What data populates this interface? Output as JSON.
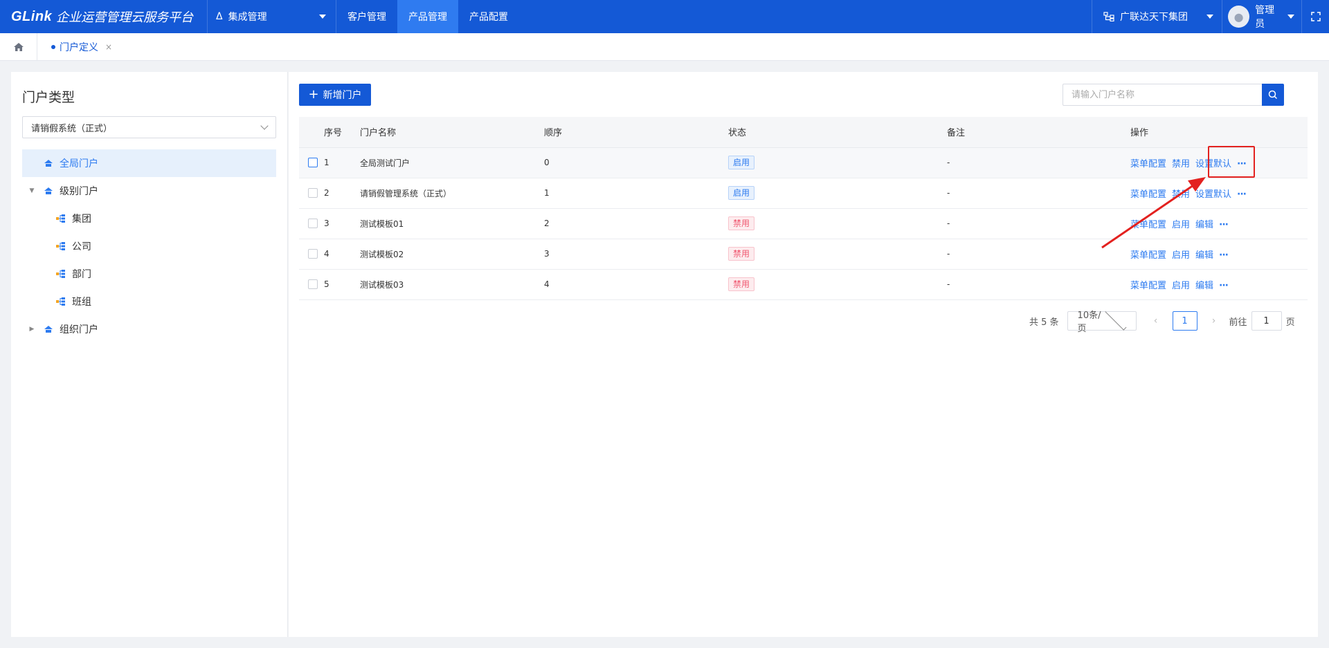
{
  "topbar": {
    "brand": "GLink",
    "title": "企业运营管理云服务平台",
    "module": "集成管理",
    "nav": [
      "客户管理",
      "产品管理",
      "产品配置"
    ],
    "active_nav": "产品管理",
    "org": "广联达天下集团",
    "user": "管理员"
  },
  "tabs": {
    "current": "门户定义",
    "close": "×"
  },
  "left": {
    "title": "门户类型",
    "select_value": "请销假系统（正式）",
    "tree": [
      {
        "label": "全局门户",
        "level": 0,
        "selected": true
      },
      {
        "label": "级别门户",
        "level": 0,
        "expanded": true
      },
      {
        "label": "集团",
        "level": 1
      },
      {
        "label": "公司",
        "level": 1
      },
      {
        "label": "部门",
        "level": 1
      },
      {
        "label": "班组",
        "level": 1
      },
      {
        "label": "组织门户",
        "level": 0,
        "collapsed": true
      }
    ]
  },
  "main": {
    "add_button": "新增门户",
    "search_placeholder": "请输入门户名称",
    "columns": [
      "序号",
      "门户名称",
      "顺序",
      "状态",
      "备注",
      "操作"
    ],
    "rows": [
      {
        "no": "1",
        "name": "全局测试门户",
        "order": "0",
        "status": "启用",
        "status_type": "on",
        "remark": "-",
        "ops": [
          "菜单配置",
          "禁用",
          "设置默认"
        ]
      },
      {
        "no": "2",
        "name": "请销假管理系统（正式）",
        "order": "1",
        "status": "启用",
        "status_type": "on",
        "remark": "-",
        "ops": [
          "菜单配置",
          "禁用",
          "设置默认"
        ]
      },
      {
        "no": "3",
        "name": "测试模板01",
        "order": "2",
        "status": "禁用",
        "status_type": "off",
        "remark": "-",
        "ops": [
          "菜单配置",
          "启用",
          "编辑"
        ]
      },
      {
        "no": "4",
        "name": "测试模板02",
        "order": "3",
        "status": "禁用",
        "status_type": "off",
        "remark": "-",
        "ops": [
          "菜单配置",
          "启用",
          "编辑"
        ]
      },
      {
        "no": "5",
        "name": "测试模板03",
        "order": "4",
        "status": "禁用",
        "status_type": "off",
        "remark": "-",
        "ops": [
          "菜单配置",
          "启用",
          "编辑"
        ]
      }
    ],
    "more": "···",
    "pagination": {
      "total": "共 5 条",
      "page_size": "10条/页",
      "current_page": "1",
      "goto_label": "前往",
      "goto_value": "1",
      "page_suffix": "页"
    }
  },
  "colors": {
    "primary": "#1459d6",
    "link": "#2d7bf0",
    "danger": "#f0576f",
    "annotation": "#e3211f"
  }
}
